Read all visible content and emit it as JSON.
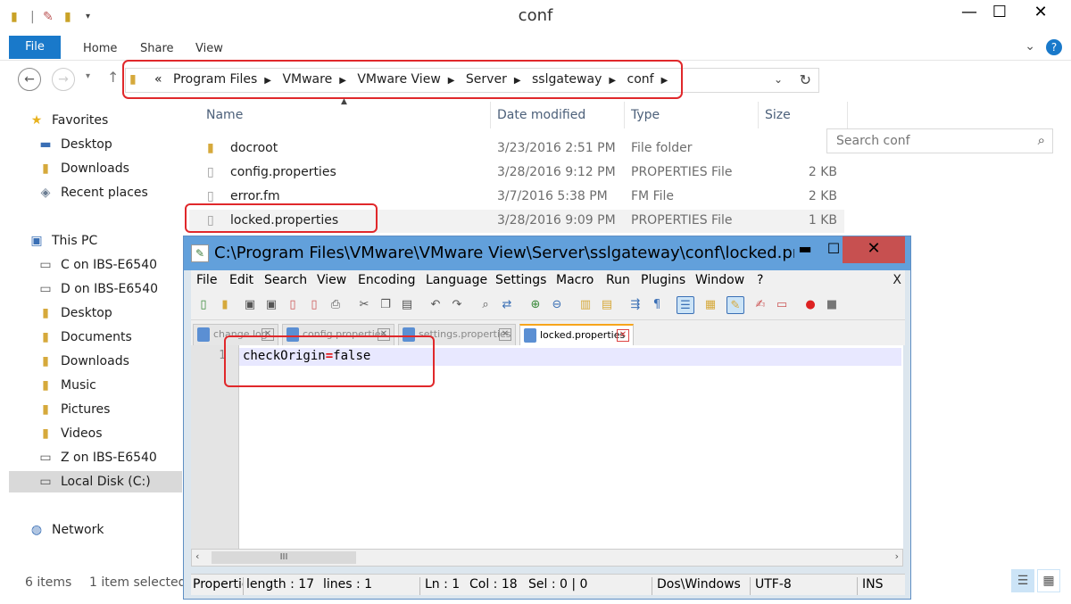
{
  "explorer": {
    "title": "conf",
    "window_controls": {
      "minimize": "—",
      "maximize": "☐",
      "close": "✕"
    },
    "ribbon": {
      "file_tab": "File",
      "tabs": [
        "Home",
        "Share",
        "View"
      ]
    },
    "address": {
      "breadcrumb": [
        "«",
        "Program Files",
        "VMware",
        "VMware View",
        "Server",
        "sslgateway",
        "conf"
      ]
    },
    "search": {
      "placeholder": "Search conf"
    },
    "nav_pane": {
      "favorites": {
        "label": "Favorites",
        "items": [
          "Desktop",
          "Downloads",
          "Recent places"
        ]
      },
      "this_pc": {
        "label": "This PC",
        "items": [
          "C on IBS-E6540",
          "D on IBS-E6540",
          "Desktop",
          "Documents",
          "Downloads",
          "Music",
          "Pictures",
          "Videos",
          "Z on IBS-E6540",
          "Local Disk (C:)"
        ]
      },
      "network": {
        "label": "Network"
      }
    },
    "columns": {
      "name": "Name",
      "date": "Date modified",
      "type": "Type",
      "size": "Size"
    },
    "files": [
      {
        "name": "docroot",
        "date": "3/23/2016 2:51 PM",
        "type": "File folder",
        "size": ""
      },
      {
        "name": "config.properties",
        "date": "3/28/2016 9:12 PM",
        "type": "PROPERTIES File",
        "size": "2 KB"
      },
      {
        "name": "error.fm",
        "date": "3/7/2016 5:38 PM",
        "type": "FM File",
        "size": "2 KB"
      },
      {
        "name": "locked.properties",
        "date": "3/28/2016 9:09 PM",
        "type": "PROPERTIES File",
        "size": "1 KB"
      }
    ],
    "status": {
      "items": "6 items",
      "selected": "1 item selected"
    }
  },
  "notepad": {
    "title": "C:\\Program Files\\VMware\\VMware View\\Server\\sslgateway\\conf\\locked.pr...",
    "menu": [
      "File",
      "Edit",
      "Search",
      "View",
      "Encoding",
      "Language",
      "Settings",
      "Macro",
      "Run",
      "Plugins",
      "Window",
      "?"
    ],
    "menu_close": "X",
    "tabs": [
      "change.log",
      "config.properties",
      "settings.properties",
      "locked.properties"
    ],
    "editor": {
      "line_number": "1",
      "code_key": "checkOrigin",
      "code_eq": "=",
      "code_value": "false"
    },
    "scroll_thumb": "III",
    "status": {
      "type": "Propertie",
      "length": "length : 17",
      "lines": "lines : 1",
      "ln": "Ln : 1",
      "col": "Col : 18",
      "sel": "Sel : 0 | 0",
      "eol": "Dos\\Windows",
      "encoding": "UTF-8",
      "mode": "INS"
    }
  },
  "colors": {
    "highlight": "#e0282b",
    "file_tab": "#1979ca",
    "npp_titlebar": "#62a0db",
    "npp_close": "#c75050"
  }
}
